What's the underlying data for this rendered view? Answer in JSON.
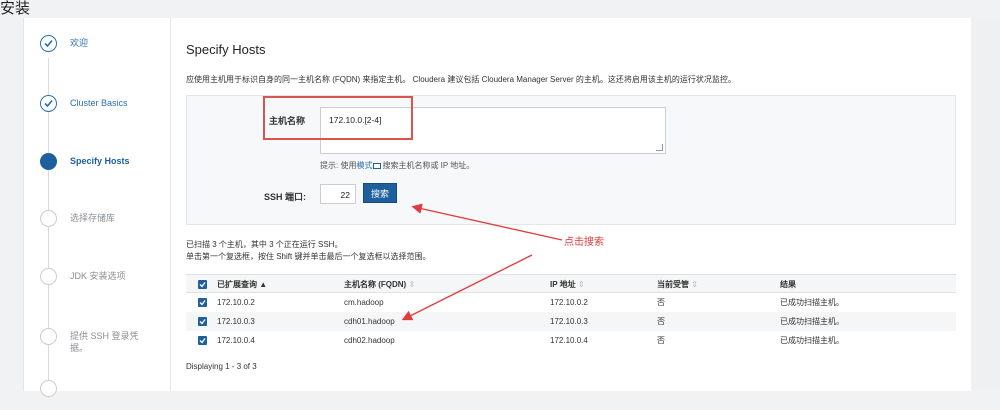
{
  "page": {
    "title": "安装"
  },
  "colors": {
    "accent": "#1f5f9e",
    "annotation": "#e23b3b"
  },
  "sidebar": {
    "steps": [
      {
        "label": "欢迎",
        "state": "done"
      },
      {
        "label": "Cluster Basics",
        "state": "done"
      },
      {
        "label": "Specify Hosts",
        "state": "active"
      },
      {
        "label": "选择存储库",
        "state": "pending"
      },
      {
        "label": "JDK 安装选项",
        "state": "pending"
      },
      {
        "label": "提供 SSH 登录凭据。",
        "state": "pending"
      }
    ]
  },
  "main": {
    "heading": "Specify Hosts",
    "description": "应使用主机用于标识自身的同一主机名称 (FQDN) 来指定主机。 Cloudera 建议包括 Cloudera Manager Server 的主机。这还将启用该主机的运行状况监控。",
    "form": {
      "hosts_label": "主机名称",
      "hosts_value": "172.10.0.[2-4]",
      "hint_prefix": "提示: 使用",
      "hint_link": "模式",
      "hint_suffix": "搜索主机名称或 IP 地址。",
      "ssh_port_label": "SSH 端口:",
      "ssh_port_value": "22",
      "search_button": "搜索"
    },
    "scan_info_line1": "已扫描 3 个主机，其中 3 个正在运行 SSH。",
    "scan_info_line2": "单击第一个复选框，按住 Shift 键并单击最后一个复选框以选择范围。",
    "annotation": "点击搜索",
    "table": {
      "columns": [
        "已扩展查询",
        "主机名称 (FQDN)",
        "IP 地址",
        "当前受管",
        "结果"
      ],
      "sort_up": "▲",
      "sort_both": "⇕",
      "rows": [
        {
          "query": "172.10.0.2",
          "hostname": "cm.hadoop",
          "ip": "172.10.0.2",
          "managed": "否",
          "result": "已成功扫描主机。"
        },
        {
          "query": "172.10.0.3",
          "hostname": "cdh01.hadoop",
          "ip": "172.10.0.3",
          "managed": "否",
          "result": "已成功扫描主机。"
        },
        {
          "query": "172.10.0.4",
          "hostname": "cdh02.hadoop",
          "ip": "172.10.0.4",
          "managed": "否",
          "result": "已成功扫描主机。"
        }
      ]
    },
    "footer": "Displaying 1 - 3 of 3"
  }
}
